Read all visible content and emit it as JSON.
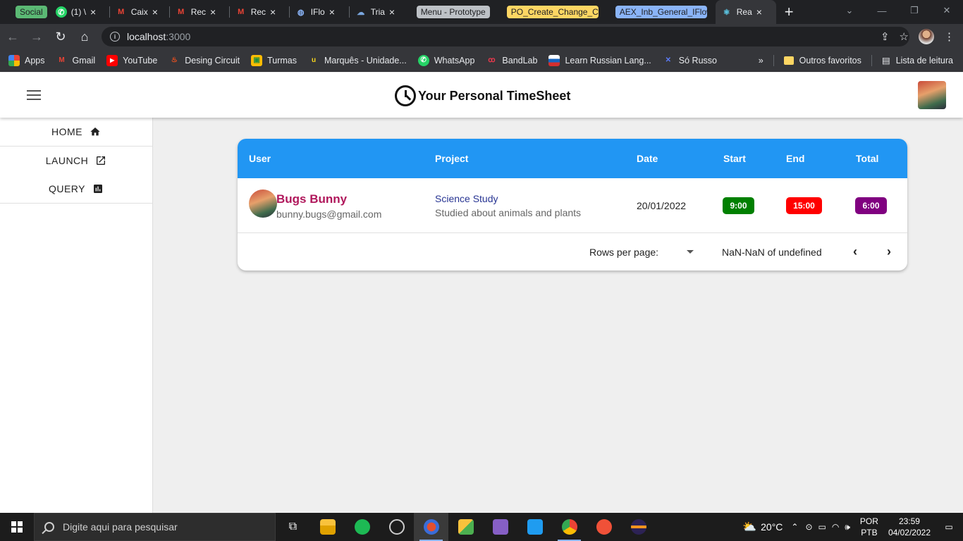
{
  "browser": {
    "tabs": [
      {
        "label": "Social",
        "type": "group",
        "color": "#5bb974",
        "text_color": "#202124"
      },
      {
        "label": "(1) \\",
        "icon": "whatsapp-icon"
      },
      {
        "label": "Caix",
        "icon": "gmail-icon"
      },
      {
        "label": "Rec",
        "icon": "gmail-icon"
      },
      {
        "label": "Rec",
        "icon": "gmail-icon"
      },
      {
        "label": "IFlo",
        "icon": "globe-icon"
      },
      {
        "label": "Tria",
        "icon": "cloud-icon"
      },
      {
        "label": "Menu - Prototype",
        "type": "group",
        "color": "#bdc1c6",
        "text_color": "#202124"
      },
      {
        "label": "PO_Create_Change_Ca",
        "type": "group",
        "color": "#fdd663",
        "text_color": "#202124"
      },
      {
        "label": "AEX_Inb_General_IFlow",
        "type": "group",
        "color": "#8ab4f8",
        "text_color": "#202124"
      },
      {
        "label": "Rea",
        "icon": "react-icon",
        "active": true
      }
    ],
    "url_host": "localhost",
    "url_port": ":3000",
    "bookmarks": [
      {
        "label": "Apps",
        "icon": "apps-grid-icon",
        "color": "#ea4335"
      },
      {
        "label": "Gmail",
        "icon": "gmail-icon",
        "color": "#ea4335"
      },
      {
        "label": "YouTube",
        "icon": "youtube-icon",
        "color": "#ff0000"
      },
      {
        "label": "Desing Circuit",
        "icon": "flame-icon",
        "color": "#f4511e"
      },
      {
        "label": "Turmas",
        "icon": "classroom-icon",
        "color": "#fbbc04"
      },
      {
        "label": "Marquês - Unidade...",
        "icon": "marques-icon",
        "color": "#f9d71c"
      },
      {
        "label": "WhatsApp",
        "icon": "whatsapp-icon",
        "color": "#25d366"
      },
      {
        "label": "BandLab",
        "icon": "bandlab-icon",
        "color": "#f0384d"
      },
      {
        "label": "Learn Russian Lang...",
        "icon": "flag-icon",
        "color": "#1565c0"
      },
      {
        "label": "Só Russo",
        "icon": "sorusso-icon",
        "color": "#5c7cfa"
      }
    ],
    "more_label": "»",
    "other_favorites": "Outros favoritos",
    "reading_list": "Lista de leitura"
  },
  "app": {
    "title": "Your Personal TimeSheet",
    "nav": [
      {
        "label": "HOME",
        "icon": "home-icon"
      },
      {
        "label": "LAUNCH",
        "icon": "open-in-new-icon"
      },
      {
        "label": "QUERY",
        "icon": "bar-chart-icon"
      }
    ],
    "table": {
      "columns": [
        "User",
        "Project",
        "Date",
        "Start",
        "End",
        "Total"
      ],
      "rows": [
        {
          "user_name": "Bugs Bunny",
          "user_email": "bunny.bugs@gmail.com",
          "project_name": "Science Study",
          "project_desc": "Studied about animals and plants",
          "date": "20/01/2022",
          "start": "9:00",
          "end": "15:00",
          "total": "6:00"
        }
      ],
      "chip_colors": {
        "start": "#008000",
        "end": "#ff0000",
        "total": "#800080"
      },
      "header_color": "#2196f3",
      "rows_per_page_label": "Rows per page:",
      "pagination_range": "NaN-NaN of undefined"
    }
  },
  "taskbar": {
    "search_placeholder": "Digite aqui para pesquisar",
    "apps": [
      {
        "name": "task-view-icon"
      },
      {
        "name": "file-explorer-icon"
      },
      {
        "name": "spotify-icon"
      },
      {
        "name": "obs-icon"
      },
      {
        "name": "postman-icon"
      },
      {
        "name": "sap-icon"
      },
      {
        "name": "visual-studio-icon"
      },
      {
        "name": "vscode-icon"
      },
      {
        "name": "chrome-icon"
      },
      {
        "name": "swift-icon"
      },
      {
        "name": "eclipse-icon"
      }
    ],
    "temperature": "20°C",
    "lang_top": "POR",
    "lang_bottom": "PTB",
    "time": "23:59",
    "date": "04/02/2022"
  }
}
